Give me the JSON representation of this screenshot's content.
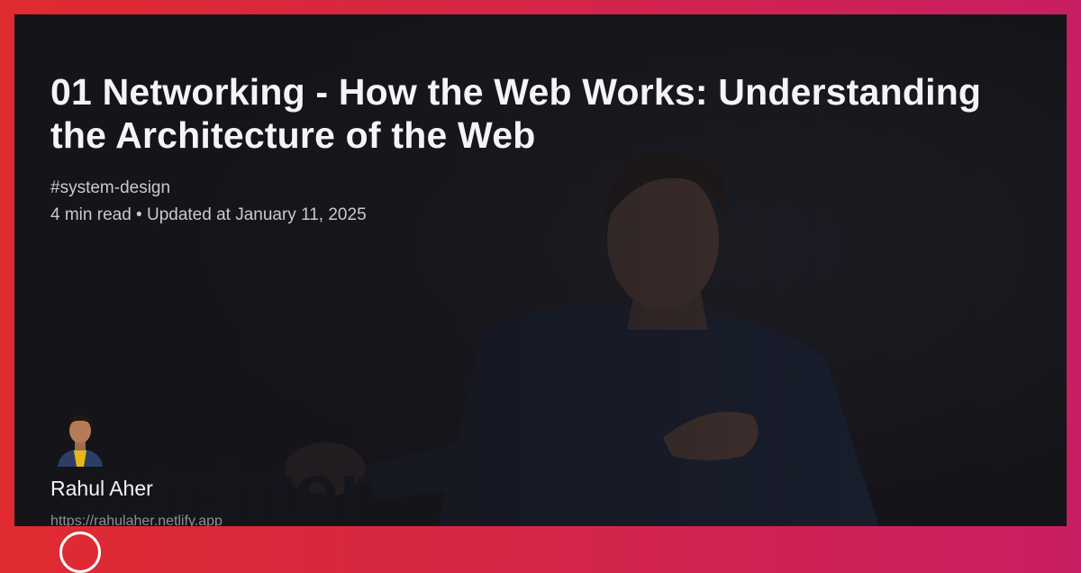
{
  "post": {
    "title": "01 Networking - How the Web Works: Understanding the Architecture of the Web",
    "tag": "#system-design",
    "meta": "4 min read • Updated at January 11, 2025"
  },
  "author": {
    "name": "Rahul Aher",
    "url": "https://rahulaher.netlify.app"
  },
  "colors": {
    "border_left": "#e02b2f",
    "border_right": "#c81e63",
    "card_background": "#141419",
    "title": "#f4f4f6",
    "meta": "#c9c9d0",
    "url": "#8e8e98"
  }
}
